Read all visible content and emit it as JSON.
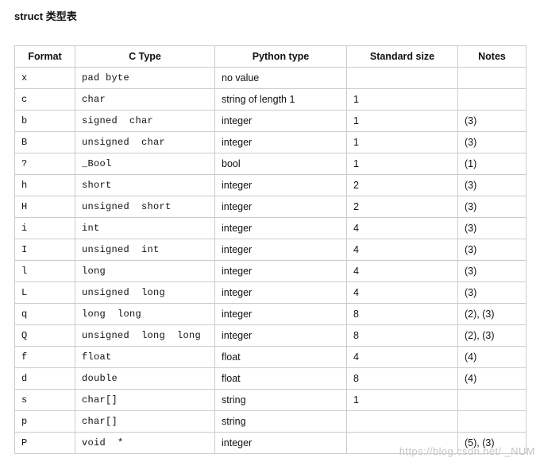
{
  "title": "struct 类型表",
  "columns": [
    "Format",
    "C Type",
    "Python type",
    "Standard size",
    "Notes"
  ],
  "rows": [
    {
      "format": "x",
      "ctype": "pad byte",
      "pytype": "no value",
      "size": "",
      "notes": ""
    },
    {
      "format": "c",
      "ctype": "char",
      "pytype": "string of length 1",
      "size": "1",
      "notes": ""
    },
    {
      "format": "b",
      "ctype": "signed  char",
      "pytype": "integer",
      "size": "1",
      "notes": "(3)"
    },
    {
      "format": "B",
      "ctype": "unsigned  char",
      "pytype": "integer",
      "size": "1",
      "notes": "(3)"
    },
    {
      "format": "?",
      "ctype": "_Bool",
      "pytype": "bool",
      "size": "1",
      "notes": "(1)"
    },
    {
      "format": "h",
      "ctype": "short",
      "pytype": "integer",
      "size": "2",
      "notes": "(3)"
    },
    {
      "format": "H",
      "ctype": "unsigned  short",
      "pytype": "integer",
      "size": "2",
      "notes": "(3)"
    },
    {
      "format": "i",
      "ctype": "int",
      "pytype": "integer",
      "size": "4",
      "notes": "(3)"
    },
    {
      "format": "I",
      "ctype": "unsigned  int",
      "pytype": "integer",
      "size": "4",
      "notes": "(3)"
    },
    {
      "format": "l",
      "ctype": "long",
      "pytype": "integer",
      "size": "4",
      "notes": "(3)"
    },
    {
      "format": "L",
      "ctype": "unsigned  long",
      "pytype": "integer",
      "size": "4",
      "notes": "(3)"
    },
    {
      "format": "q",
      "ctype": "long  long",
      "pytype": "integer",
      "size": "8",
      "notes": "(2), (3)"
    },
    {
      "format": "Q",
      "ctype": "unsigned  long  long",
      "pytype": "integer",
      "size": "8",
      "notes": "(2), (3)"
    },
    {
      "format": "f",
      "ctype": "float",
      "pytype": "float",
      "size": "4",
      "notes": "(4)"
    },
    {
      "format": "d",
      "ctype": "double",
      "pytype": "float",
      "size": "8",
      "notes": "(4)"
    },
    {
      "format": "s",
      "ctype": "char[]",
      "pytype": "string",
      "size": "1",
      "notes": ""
    },
    {
      "format": "p",
      "ctype": "char[]",
      "pytype": "string",
      "size": "",
      "notes": ""
    },
    {
      "format": "P",
      "ctype": "void  *",
      "pytype": "integer",
      "size": "",
      "notes": "(5), (3)"
    }
  ],
  "watermark": "https://blog.csdn.net/    _NUM"
}
